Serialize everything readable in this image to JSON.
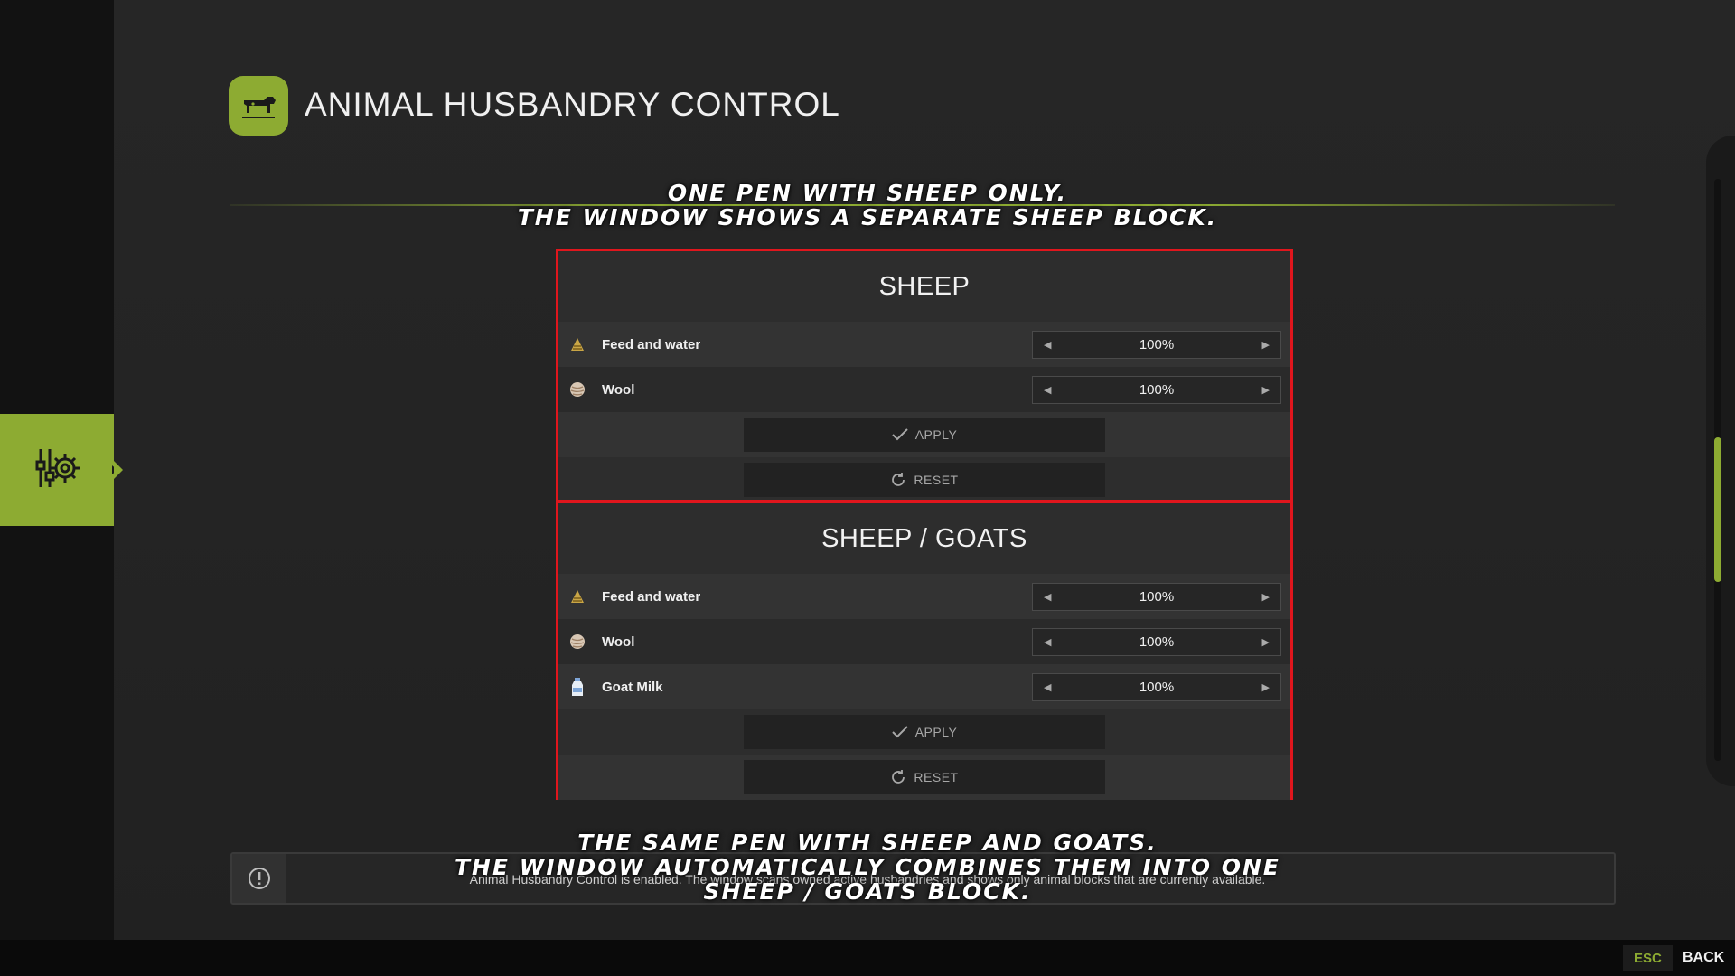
{
  "header": {
    "title": "ANIMAL HUSBANDRY CONTROL"
  },
  "captions": {
    "top": [
      "ONE PEN WITH SHEEP ONLY.",
      "THE WINDOW SHOWS A SEPARATE SHEEP BLOCK."
    ],
    "bottom": [
      "THE SAME PEN WITH SHEEP AND GOATS.",
      "THE WINDOW AUTOMATICALLY COMBINES THEM INTO ONE",
      "SHEEP / GOATS BLOCK."
    ]
  },
  "blocks": [
    {
      "title": "SHEEP",
      "rows": [
        {
          "label": "Feed and water",
          "value": "100%",
          "icon": "feed-icon"
        },
        {
          "label": "Wool",
          "value": "100%",
          "icon": "wool-icon"
        }
      ],
      "apply_label": "APPLY",
      "reset_label": "RESET"
    },
    {
      "title": "SHEEP / GOATS",
      "rows": [
        {
          "label": "Feed and water",
          "value": "100%",
          "icon": "feed-icon"
        },
        {
          "label": "Wool",
          "value": "100%",
          "icon": "wool-icon"
        },
        {
          "label": "Goat Milk",
          "value": "100%",
          "icon": "milk-bottle-icon"
        }
      ],
      "apply_label": "APPLY",
      "reset_label": "RESET"
    }
  ],
  "info": {
    "text": "Animal Husbandry Control is enabled. The window scans owned active husbandries and shows only animal blocks that are currently available."
  },
  "footer": {
    "esc_key": "ESC",
    "back_label": "BACK"
  },
  "colors": {
    "accent": "#8dab32",
    "highlight_border": "#e0161d"
  }
}
